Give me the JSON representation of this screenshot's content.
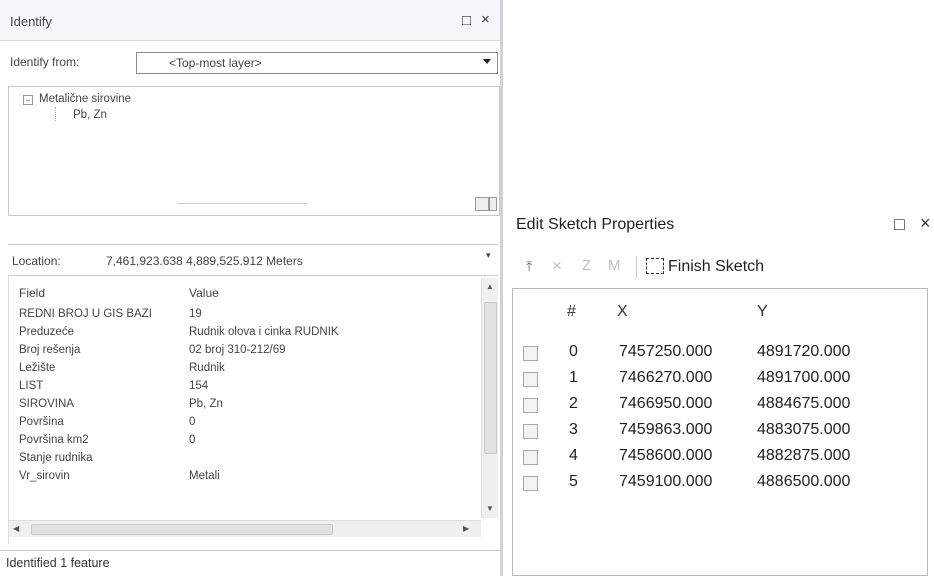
{
  "identify": {
    "title": "Identify",
    "window_buttons": {
      "restore": "□",
      "close": "×"
    },
    "identify_from_label": "Identify from:",
    "identify_from_value": "<Top-most layer>",
    "tree": {
      "root": "Metalične sirovine",
      "child": "Pb, Zn"
    },
    "location_label": "Location:",
    "location_value": "7,461,923.638  4,889,525.912 Meters",
    "table": {
      "headers": [
        "Field",
        "Value"
      ],
      "rows": [
        [
          "REDNI BROJ U GIS BAZI",
          "19"
        ],
        [
          "Preduzeće",
          "Rudnik olova i cinka RUDNIK"
        ],
        [
          "Broj rešenja",
          "02 broj 310-212/69"
        ],
        [
          "Ležište",
          "Rudnik"
        ],
        [
          "LIST",
          "154"
        ],
        [
          "SIROVINA",
          "Pb, Zn"
        ],
        [
          "Površina",
          "0"
        ],
        [
          "Površina km2",
          "0"
        ],
        [
          "Stanje rudnika",
          ""
        ],
        [
          "Vr_sirovin",
          "Metali"
        ]
      ]
    },
    "status": "Identified 1 feature"
  },
  "sketch": {
    "title": "Edit Sketch Properties",
    "window_buttons": {
      "restore": "□",
      "close": "×"
    },
    "toolbar": {
      "delete": "×",
      "z": "Z",
      "m": "M",
      "finish": "Finish Sketch"
    },
    "columns": [
      "#",
      "X",
      "Y"
    ],
    "vertices": [
      [
        "0",
        "7457250.000",
        "4891720.000"
      ],
      [
        "1",
        "7466270.000",
        "4891700.000"
      ],
      [
        "2",
        "7466950.000",
        "4884675.000"
      ],
      [
        "3",
        "7459863.000",
        "4883075.000"
      ],
      [
        "4",
        "7458600.000",
        "4882875.000"
      ],
      [
        "5",
        "7459100.000",
        "4886500.000"
      ]
    ]
  }
}
